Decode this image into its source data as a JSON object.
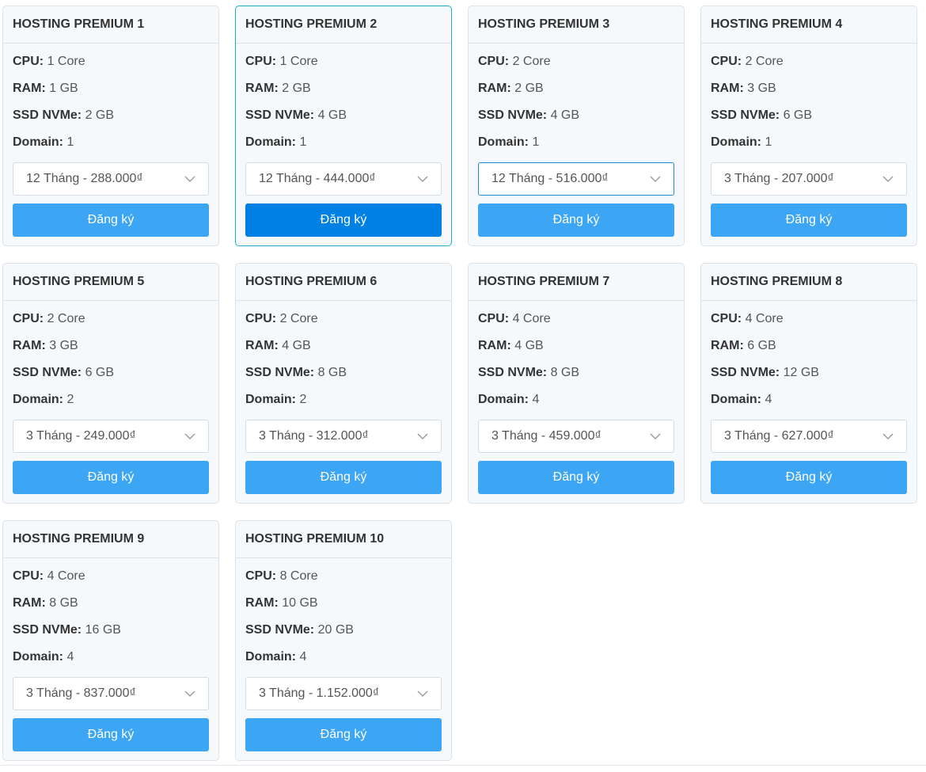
{
  "plans": [
    {
      "name": "HOSTING PREMIUM 1",
      "cpu": "1 Core",
      "ram": "1 GB",
      "ssd": "2 GB",
      "domain": "1",
      "price": "12 Tháng - 288.000₫",
      "button": "Đăng ký"
    },
    {
      "name": "HOSTING PREMIUM 2",
      "cpu": "1 Core",
      "ram": "2 GB",
      "ssd": "4 GB",
      "domain": "1",
      "price": "12 Tháng - 444.000₫",
      "button": "Đăng ký"
    },
    {
      "name": "HOSTING PREMIUM 3",
      "cpu": "2 Core",
      "ram": "2 GB",
      "ssd": "4 GB",
      "domain": "1",
      "price": "12 Tháng - 516.000₫",
      "button": "Đăng ký"
    },
    {
      "name": "HOSTING PREMIUM 4",
      "cpu": "2 Core",
      "ram": "3 GB",
      "ssd": "6 GB",
      "domain": "1",
      "price": "3 Tháng - 207.000₫",
      "button": "Đăng ký"
    },
    {
      "name": "HOSTING PREMIUM 5",
      "cpu": "2 Core",
      "ram": "3 GB",
      "ssd": "6 GB",
      "domain": "2",
      "price": "3 Tháng - 249.000₫",
      "button": "Đăng ký"
    },
    {
      "name": "HOSTING PREMIUM 6",
      "cpu": "2 Core",
      "ram": "4 GB",
      "ssd": "8 GB",
      "domain": "2",
      "price": "3 Tháng - 312.000₫",
      "button": "Đăng ký"
    },
    {
      "name": "HOSTING PREMIUM 7",
      "cpu": "4 Core",
      "ram": "4 GB",
      "ssd": "8 GB",
      "domain": "4",
      "price": "3 Tháng - 459.000₫",
      "button": "Đăng ký"
    },
    {
      "name": "HOSTING PREMIUM 8",
      "cpu": "4 Core",
      "ram": "6 GB",
      "ssd": "12 GB",
      "domain": "4",
      "price": "3 Tháng - 627.000₫",
      "button": "Đăng ký"
    },
    {
      "name": "HOSTING PREMIUM 9",
      "cpu": "4 Core",
      "ram": "8 GB",
      "ssd": "16 GB",
      "domain": "4",
      "price": "3 Tháng - 837.000₫",
      "button": "Đăng ký"
    },
    {
      "name": "HOSTING PREMIUM 10",
      "cpu": "8 Core",
      "ram": "10 GB",
      "ssd": "20 GB",
      "domain": "4",
      "price": "3 Tháng - 1.152.000₫",
      "button": "Đăng ký"
    }
  ],
  "labels": {
    "cpu": "CPU:",
    "ram": "RAM:",
    "ssd": "SSD NVMe:",
    "domain": "Domain:"
  },
  "colors": {
    "button": "#3ca6f5",
    "button_active": "#0180e3",
    "highlight_border": "#1fb0c8",
    "card_bg": "#f6f9fc"
  },
  "icons": {
    "select": "chevron-down-icon"
  }
}
